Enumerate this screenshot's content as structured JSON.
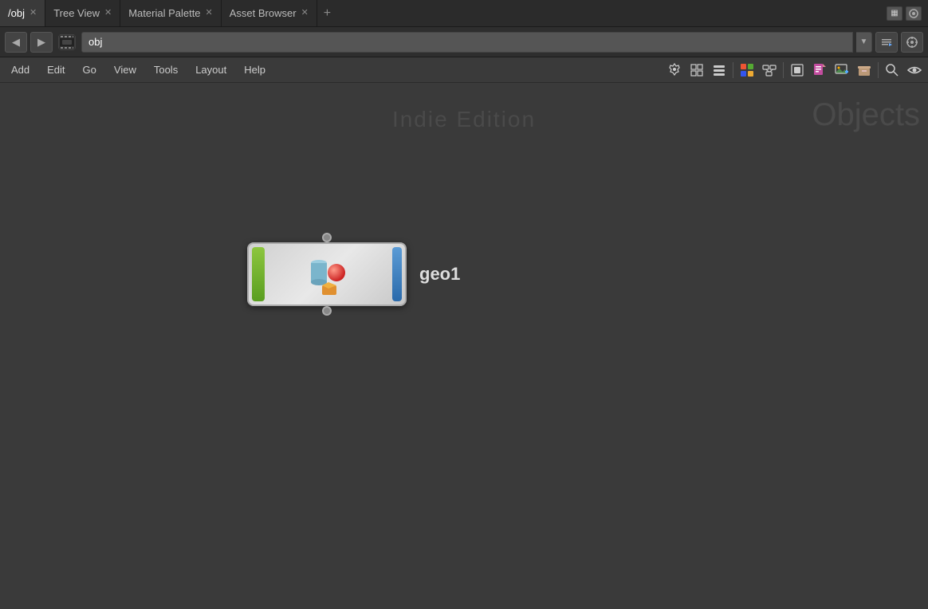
{
  "tabs": [
    {
      "id": "obj",
      "label": "/obj",
      "active": true,
      "closable": true
    },
    {
      "id": "tree-view",
      "label": "Tree View",
      "active": false,
      "closable": true
    },
    {
      "id": "material-palette",
      "label": "Material Palette",
      "active": false,
      "closable": true
    },
    {
      "id": "asset-browser",
      "label": "Asset Browser",
      "active": false,
      "closable": true
    }
  ],
  "address": {
    "back_label": "◀",
    "forward_label": "▶",
    "value": "obj",
    "dropdown_label": "▼"
  },
  "menu": {
    "items": [
      {
        "label": "Add"
      },
      {
        "label": "Edit"
      },
      {
        "label": "Go"
      },
      {
        "label": "View"
      },
      {
        "label": "Tools"
      },
      {
        "label": "Layout"
      },
      {
        "label": "Help"
      }
    ]
  },
  "watermark": {
    "edition": "Indie Edition",
    "category": "Objects"
  },
  "node": {
    "label": "geo1"
  },
  "toolbar": {
    "search_icon": "🔍",
    "view_icon": "👁"
  }
}
